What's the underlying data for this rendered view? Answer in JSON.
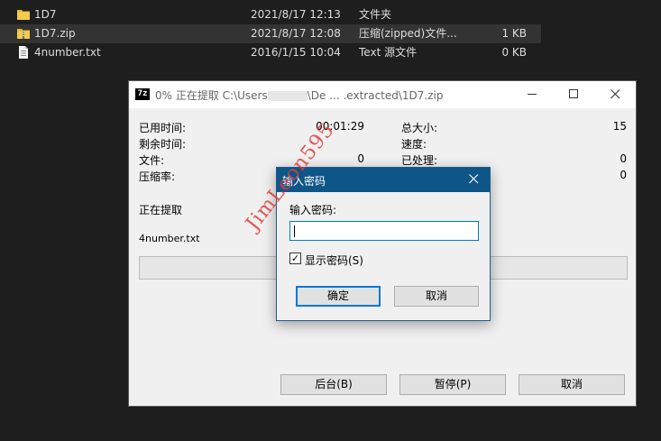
{
  "explorer": {
    "files": [
      {
        "name": "1D7",
        "date": "2021/8/17 12:13",
        "type": "文件夹",
        "size": "",
        "icon": "folder-icon"
      },
      {
        "name": "1D7.zip",
        "date": "2021/8/17 12:08",
        "type": "压缩(zipped)文件...",
        "size": "1 KB",
        "icon": "zip-folder-icon"
      },
      {
        "name": "4number.txt",
        "date": "2016/1/15 10:04",
        "type": "Text 源文件",
        "size": "0 KB",
        "icon": "text-file-icon"
      }
    ]
  },
  "extract_window": {
    "logo": "7z",
    "title_prefix": "0% 正在提取 C:\\Users",
    "title_suffix": "\\De ... .extracted\\1D7.zip",
    "labels": {
      "elapsed": "已用时间:",
      "remaining": "剩余时间:",
      "files": "文件:",
      "ratio": "压缩率:",
      "total_size": "总大小:",
      "speed": "速度:",
      "processed": "已处理:"
    },
    "values": {
      "elapsed": "00:01:29",
      "files": "0",
      "total_size": "15",
      "processed": "0",
      "processed_extra": "0"
    },
    "status": "正在提取",
    "current_file": "4number.txt",
    "progress": 0,
    "buttons": {
      "background": "后台(B)",
      "pause": "暂停(P)",
      "cancel": "取消"
    }
  },
  "password_dialog": {
    "title": "输入密码",
    "prompt": "输入密码:",
    "value": "",
    "show_password_label": "显示密码(S)",
    "show_password_checked": "✓",
    "ok": "确定",
    "cancel": "取消"
  },
  "watermark": "JimLeon595",
  "colors": {
    "dialog_title": "#0f5688",
    "input_focus": "#0078d7",
    "watermark": "#e23b3b"
  }
}
